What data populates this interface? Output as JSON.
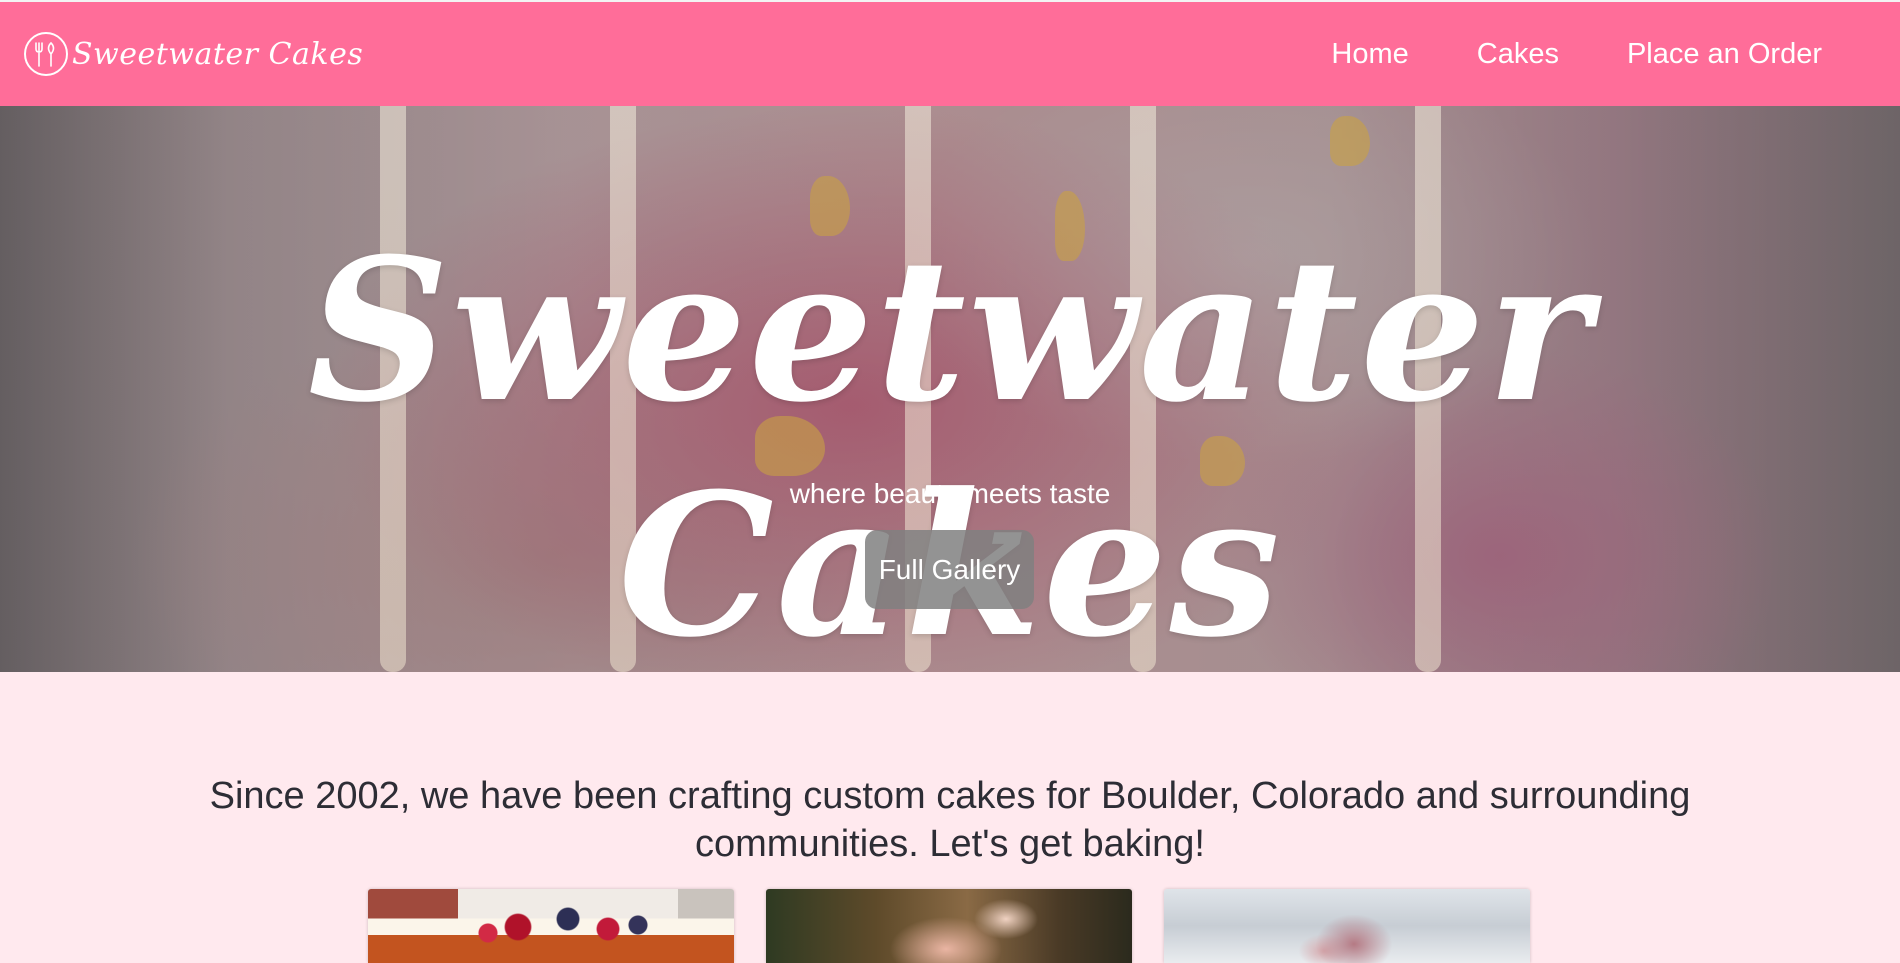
{
  "nav": {
    "brand_name": "Sweetwater Cakes",
    "logo_icon": "utensils-icon",
    "links": [
      {
        "label": "Home"
      },
      {
        "label": "Cakes"
      },
      {
        "label": "Place an Order"
      }
    ]
  },
  "hero": {
    "title": "Sweetwater Cakes",
    "subtitle": "where beauty meets taste",
    "button_label": "Full Gallery"
  },
  "intro": {
    "text": "Since 2002, we have been crafting custom cakes for Boulder, Colorado and surrounding communities. Let's get baking!"
  },
  "colors": {
    "nav_background": "#ff6d99",
    "page_background": "#ffe9ee",
    "button_background": "#808080"
  }
}
